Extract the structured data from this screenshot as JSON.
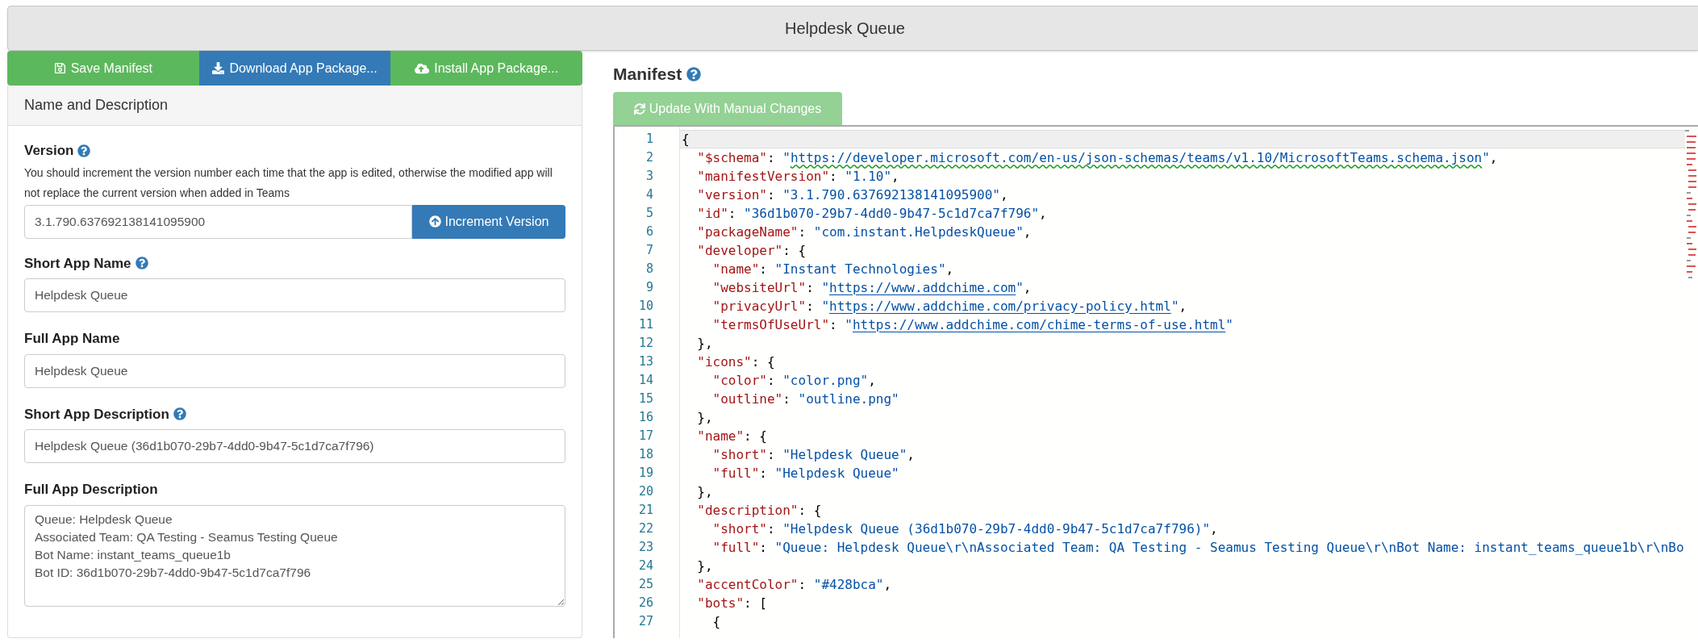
{
  "title_bar": {
    "title": "Helpdesk Queue"
  },
  "actions": [
    {
      "label": "Save Manifest",
      "kind": "save"
    },
    {
      "label": "Download App Package...",
      "kind": "download"
    },
    {
      "label": "Install App Package...",
      "kind": "install"
    }
  ],
  "panel": {
    "heading": "Name and Description",
    "fields": [
      {
        "kind": "version",
        "label": "Version",
        "help": true,
        "description": "You should increment the version number each time that the app is edited, otherwise the modified app will not replace the current version when added in Teams",
        "value": "3.1.790.637692138141095900",
        "button": "Increment Version"
      },
      {
        "kind": "text",
        "label": "Short App Name",
        "help": true,
        "value": "Helpdesk Queue"
      },
      {
        "kind": "text",
        "label": "Full App Name",
        "help": false,
        "value": "Helpdesk Queue"
      },
      {
        "kind": "text",
        "label": "Short App Description",
        "help": true,
        "value": "Helpdesk Queue (36d1b070-29b7-4dd0-9b47-5c1d7ca7f796)"
      },
      {
        "kind": "textarea",
        "label": "Full App Description",
        "help": false,
        "lines": [
          "Queue: Helpdesk Queue",
          "Associated Team: QA Testing - Seamus Testing Queue",
          "Bot Name: instant_teams_queue1b",
          "Bot ID: 36d1b070-29b7-4dd0-9b47-5c1d7ca7f796"
        ]
      }
    ]
  },
  "manifest": {
    "heading": "Manifest",
    "help": true,
    "update_button": {
      "label": "Update With Manual Changes",
      "disabled": true
    },
    "lines": [
      {
        "number": "1",
        "current": true,
        "tokens": [
          {
            "kind": "punct",
            "text": "{"
          }
        ]
      },
      {
        "number": "2",
        "current": false,
        "tokens": [
          {
            "kind": "key",
            "text": "  \"$schema\""
          },
          {
            "kind": "punct",
            "text": ": "
          },
          {
            "kind": "string",
            "text": "\""
          },
          {
            "kind": "link-warning",
            "text": "https://developer.microsoft.com/en-us/json-schemas/teams/v1.10/MicrosoftTeams.schema.json"
          },
          {
            "kind": "string",
            "text": "\""
          },
          {
            "kind": "punct",
            "text": ","
          }
        ]
      },
      {
        "number": "3",
        "current": false,
        "tokens": [
          {
            "kind": "key",
            "text": "  \"manifestVersion\""
          },
          {
            "kind": "punct",
            "text": ": "
          },
          {
            "kind": "string",
            "text": "\"1.10\""
          },
          {
            "kind": "punct",
            "text": ","
          }
        ]
      },
      {
        "number": "4",
        "current": false,
        "tokens": [
          {
            "kind": "key",
            "text": "  \"version\""
          },
          {
            "kind": "punct",
            "text": ": "
          },
          {
            "kind": "string",
            "text": "\"3.1.790.637692138141095900\""
          },
          {
            "kind": "punct",
            "text": ","
          }
        ]
      },
      {
        "number": "5",
        "current": false,
        "tokens": [
          {
            "kind": "key",
            "text": "  \"id\""
          },
          {
            "kind": "punct",
            "text": ": "
          },
          {
            "kind": "string",
            "text": "\"36d1b070-29b7-4dd0-9b47-5c1d7ca7f796\""
          },
          {
            "kind": "punct",
            "text": ","
          }
        ]
      },
      {
        "number": "6",
        "current": false,
        "tokens": [
          {
            "kind": "key",
            "text": "  \"packageName\""
          },
          {
            "kind": "punct",
            "text": ": "
          },
          {
            "kind": "string",
            "text": "\"com.instant.HelpdeskQueue\""
          },
          {
            "kind": "punct",
            "text": ","
          }
        ]
      },
      {
        "number": "7",
        "current": false,
        "tokens": [
          {
            "kind": "key",
            "text": "  \"developer\""
          },
          {
            "kind": "punct",
            "text": ": {"
          }
        ]
      },
      {
        "number": "8",
        "current": false,
        "tokens": [
          {
            "kind": "key",
            "text": "    \"name\""
          },
          {
            "kind": "punct",
            "text": ": "
          },
          {
            "kind": "string",
            "text": "\"Instant Technologies\""
          },
          {
            "kind": "punct",
            "text": ","
          }
        ]
      },
      {
        "number": "9",
        "current": false,
        "tokens": [
          {
            "kind": "key",
            "text": "    \"websiteUrl\""
          },
          {
            "kind": "punct",
            "text": ": "
          },
          {
            "kind": "string",
            "text": "\""
          },
          {
            "kind": "link",
            "text": "https://www.addchime.com"
          },
          {
            "kind": "string",
            "text": "\""
          },
          {
            "kind": "punct",
            "text": ","
          }
        ]
      },
      {
        "number": "10",
        "current": false,
        "tokens": [
          {
            "kind": "key",
            "text": "    \"privacyUrl\""
          },
          {
            "kind": "punct",
            "text": ": "
          },
          {
            "kind": "string",
            "text": "\""
          },
          {
            "kind": "link",
            "text": "https://www.addchime.com/privacy-policy.html"
          },
          {
            "kind": "string",
            "text": "\""
          },
          {
            "kind": "punct",
            "text": ","
          }
        ]
      },
      {
        "number": "11",
        "current": false,
        "tokens": [
          {
            "kind": "key",
            "text": "    \"termsOfUseUrl\""
          },
          {
            "kind": "punct",
            "text": ": "
          },
          {
            "kind": "string",
            "text": "\""
          },
          {
            "kind": "link",
            "text": "https://www.addchime.com/chime-terms-of-use.html"
          },
          {
            "kind": "string",
            "text": "\""
          }
        ]
      },
      {
        "number": "12",
        "current": false,
        "tokens": [
          {
            "kind": "punct",
            "text": "  },"
          }
        ]
      },
      {
        "number": "13",
        "current": false,
        "tokens": [
          {
            "kind": "key",
            "text": "  \"icons\""
          },
          {
            "kind": "punct",
            "text": ": {"
          }
        ]
      },
      {
        "number": "14",
        "current": false,
        "tokens": [
          {
            "kind": "key",
            "text": "    \"color\""
          },
          {
            "kind": "punct",
            "text": ": "
          },
          {
            "kind": "string",
            "text": "\"color.png\""
          },
          {
            "kind": "punct",
            "text": ","
          }
        ]
      },
      {
        "number": "15",
        "current": false,
        "tokens": [
          {
            "kind": "key",
            "text": "    \"outline\""
          },
          {
            "kind": "punct",
            "text": ": "
          },
          {
            "kind": "string",
            "text": "\"outline.png\""
          }
        ]
      },
      {
        "number": "16",
        "current": false,
        "tokens": [
          {
            "kind": "punct",
            "text": "  },"
          }
        ]
      },
      {
        "number": "17",
        "current": false,
        "tokens": [
          {
            "kind": "key",
            "text": "  \"name\""
          },
          {
            "kind": "punct",
            "text": ": {"
          }
        ]
      },
      {
        "number": "18",
        "current": false,
        "tokens": [
          {
            "kind": "key",
            "text": "    \"short\""
          },
          {
            "kind": "punct",
            "text": ": "
          },
          {
            "kind": "string",
            "text": "\"Helpdesk Queue\""
          },
          {
            "kind": "punct",
            "text": ","
          }
        ]
      },
      {
        "number": "19",
        "current": false,
        "tokens": [
          {
            "kind": "key",
            "text": "    \"full\""
          },
          {
            "kind": "punct",
            "text": ": "
          },
          {
            "kind": "string",
            "text": "\"Helpdesk Queue\""
          }
        ]
      },
      {
        "number": "20",
        "current": false,
        "tokens": [
          {
            "kind": "punct",
            "text": "  },"
          }
        ]
      },
      {
        "number": "21",
        "current": false,
        "tokens": [
          {
            "kind": "key",
            "text": "  \"description\""
          },
          {
            "kind": "punct",
            "text": ": {"
          }
        ]
      },
      {
        "number": "22",
        "current": false,
        "tokens": [
          {
            "kind": "key",
            "text": "    \"short\""
          },
          {
            "kind": "punct",
            "text": ": "
          },
          {
            "kind": "string",
            "text": "\"Helpdesk Queue (36d1b070-29b7-4dd0-9b47-5c1d7ca7f796)\""
          },
          {
            "kind": "punct",
            "text": ","
          }
        ]
      },
      {
        "number": "23",
        "current": false,
        "tokens": [
          {
            "kind": "key",
            "text": "    \"full\""
          },
          {
            "kind": "punct",
            "text": ": "
          },
          {
            "kind": "string",
            "text": "\"Queue: Helpdesk Queue\\r\\nAssociated Team: QA Testing - Seamus Testing Queue\\r\\nBot Name: instant_teams_queue1b\\r\\nBo"
          }
        ]
      },
      {
        "number": "24",
        "current": false,
        "tokens": [
          {
            "kind": "punct",
            "text": "  },"
          }
        ]
      },
      {
        "number": "25",
        "current": false,
        "tokens": [
          {
            "kind": "key",
            "text": "  \"accentColor\""
          },
          {
            "kind": "punct",
            "text": ": "
          },
          {
            "kind": "string",
            "text": "\"#428bca\""
          },
          {
            "kind": "punct",
            "text": ","
          }
        ]
      },
      {
        "number": "26",
        "current": false,
        "tokens": [
          {
            "kind": "key",
            "text": "  \"bots\""
          },
          {
            "kind": "punct",
            "text": ": ["
          }
        ]
      },
      {
        "number": "27",
        "current": false,
        "tokens": [
          {
            "kind": "punct",
            "text": "    {"
          }
        ]
      }
    ]
  }
}
